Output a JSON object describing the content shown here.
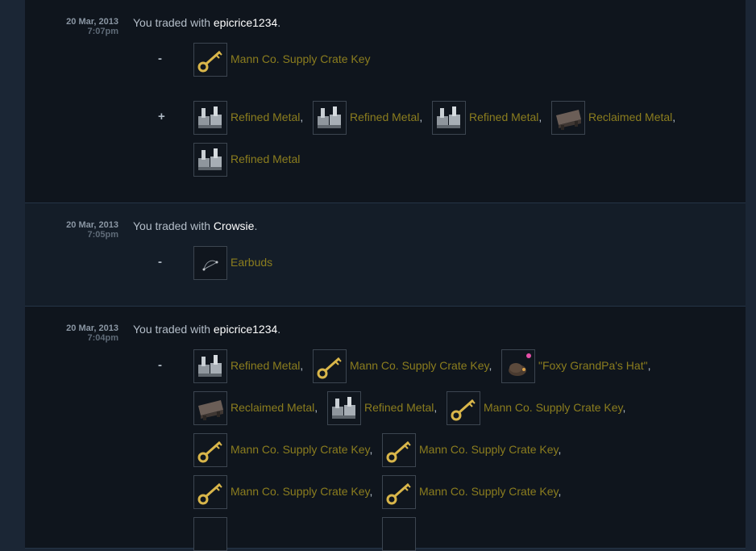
{
  "trades": [
    {
      "date": "20 Mar, 2013",
      "time": "7:07pm",
      "prefix": "You traded with ",
      "partner": "epicrice1234",
      "suffix": ".",
      "groups": [
        {
          "sign": "-",
          "items": [
            {
              "name": "Mann Co. Supply Crate Key",
              "icon": "key-icon",
              "comma": ""
            }
          ]
        },
        {
          "sign": "+",
          "items": [
            {
              "name": "Refined Metal",
              "icon": "refined-metal-icon",
              "comma": ","
            },
            {
              "name": "Refined Metal",
              "icon": "refined-metal-icon",
              "comma": ","
            },
            {
              "name": "Refined Metal",
              "icon": "refined-metal-icon",
              "comma": ","
            },
            {
              "name": "Reclaimed Metal",
              "icon": "reclaimed-metal-icon",
              "comma": ","
            },
            {
              "name": "Refined Metal",
              "icon": "refined-metal-icon",
              "comma": ""
            }
          ]
        }
      ]
    },
    {
      "date": "20 Mar, 2013",
      "time": "7:05pm",
      "prefix": "You traded with ",
      "partner": "Crowsie",
      "suffix": ".",
      "groups": [
        {
          "sign": "-",
          "items": [
            {
              "name": "Earbuds",
              "icon": "earbuds-icon",
              "comma": ""
            }
          ]
        }
      ]
    },
    {
      "date": "20 Mar, 2013",
      "time": "7:04pm",
      "prefix": "You traded with ",
      "partner": "epicrice1234",
      "suffix": ".",
      "groups": [
        {
          "sign": "-",
          "items": [
            {
              "name": "Refined Metal",
              "icon": "refined-metal-icon",
              "comma": ","
            },
            {
              "name": "Mann Co. Supply Crate Key",
              "icon": "key-icon",
              "comma": ","
            },
            {
              "name": "\"Foxy GrandPa's Hat\"",
              "icon": "hat-icon",
              "comma": ","
            },
            {
              "name": "Reclaimed Metal",
              "icon": "reclaimed-metal-icon",
              "comma": ","
            },
            {
              "name": "Refined Metal",
              "icon": "refined-metal-icon",
              "comma": ","
            },
            {
              "name": "Mann Co. Supply Crate Key",
              "icon": "key-icon",
              "comma": ","
            },
            {
              "name": "Mann Co. Supply Crate Key",
              "icon": "key-icon",
              "comma": ","
            },
            {
              "name": "Mann Co. Supply Crate Key",
              "icon": "key-icon",
              "comma": ","
            },
            {
              "name": "Mann Co. Supply Crate Key",
              "icon": "key-icon",
              "comma": ","
            },
            {
              "name": "Mann Co. Supply Crate Key",
              "icon": "key-icon",
              "comma": ","
            }
          ]
        }
      ]
    }
  ],
  "colors": {
    "item_name": "#8b7d1e",
    "partner": "#ffffff",
    "text": "#b4bec9"
  }
}
